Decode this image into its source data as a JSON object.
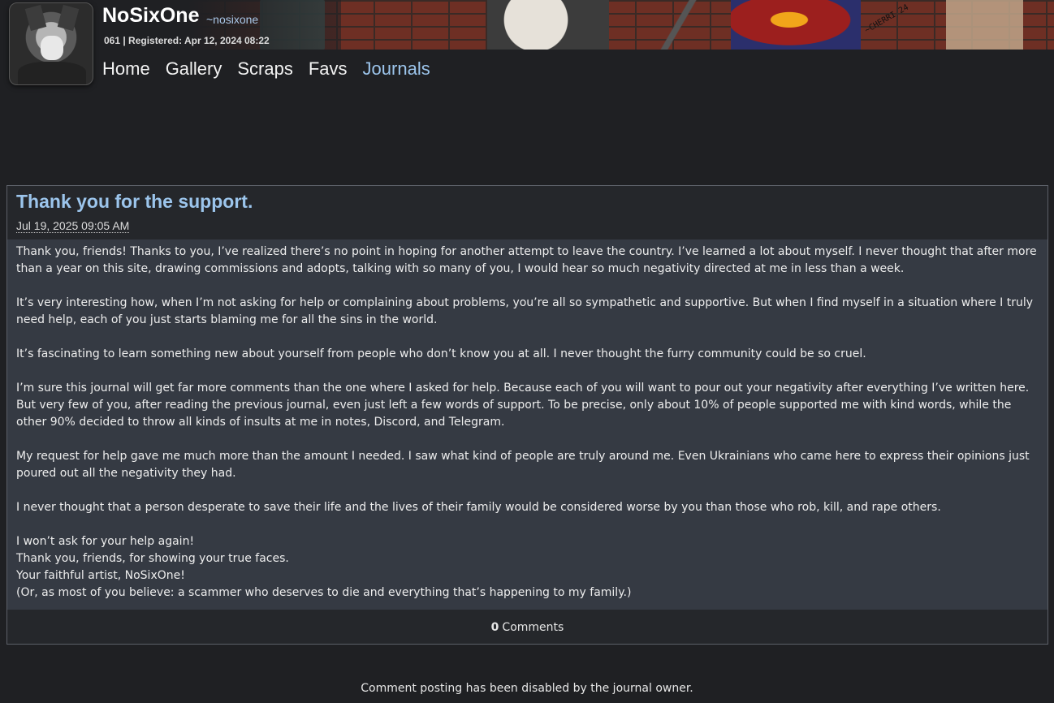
{
  "profile": {
    "username": "NoSixOne",
    "handle": "~nosixone",
    "registration": "061 | Registered: Apr 12, 2024 08:22",
    "avatar": "wolf-avatar",
    "banner_signature": "~CHERRI 24"
  },
  "nav": {
    "items": [
      {
        "label": "Home",
        "active": false
      },
      {
        "label": "Gallery",
        "active": false
      },
      {
        "label": "Scraps",
        "active": false
      },
      {
        "label": "Favs",
        "active": false
      },
      {
        "label": "Journals",
        "active": true
      }
    ]
  },
  "journal": {
    "title": "Thank you for the support.",
    "date": "Jul 19, 2025 09:05 AM",
    "paragraphs": [
      "Thank you, friends! Thanks to you, I’ve realized there’s no point in hoping for another attempt to leave the country. I’ve learned a lot about myself. I never thought that after more than a year on this site, drawing commissions and adopts, talking with so many of you, I would hear so much negativity directed at me in less than a week.",
      "It’s very interesting how, when I’m not asking for help or complaining about problems, you’re all so sympathetic and supportive. But when I find myself in a situation where I truly need help, each of you just starts blaming me for all the sins in the world.",
      "It’s fascinating to learn something new about yourself from people who don’t know you at all. I never thought the furry community could be so cruel.",
      "I’m sure this journal will get far more comments than the one where I asked for help. Because each of you will want to pour out your negativity after everything I’ve written here. But very few of you, after reading the previous journal, even just left a few words of support. To be precise, only about 10% of people supported me with kind words, while the other 90% decided to throw all kinds of insults at me in notes, Discord, and Telegram.",
      "My request for help gave me much more than the amount I needed. I saw what kind of people are truly around me. Even Ukrainians who came here to express their opinions just poured out all the negativity they had.",
      "I never thought that a person desperate to save their life and the lives of their family would be considered worse by you than those who rob, kill, and rape others."
    ],
    "closing_lines": [
      "I won’t ask for your help again!",
      "Thank you, friends, for showing your true faces.",
      "Your faithful artist, NoSixOne!",
      "(Or, as most of you believe: a scammer who deserves to die and everything that’s happening to my family.)"
    ],
    "comments_count": "0",
    "comments_label": "Comments"
  },
  "footer": {
    "note": "Comment posting has been disabled by the journal owner."
  },
  "colors": {
    "background": "#1f2023",
    "link_active": "#9cc5ec",
    "journal_body": "#353a43"
  }
}
